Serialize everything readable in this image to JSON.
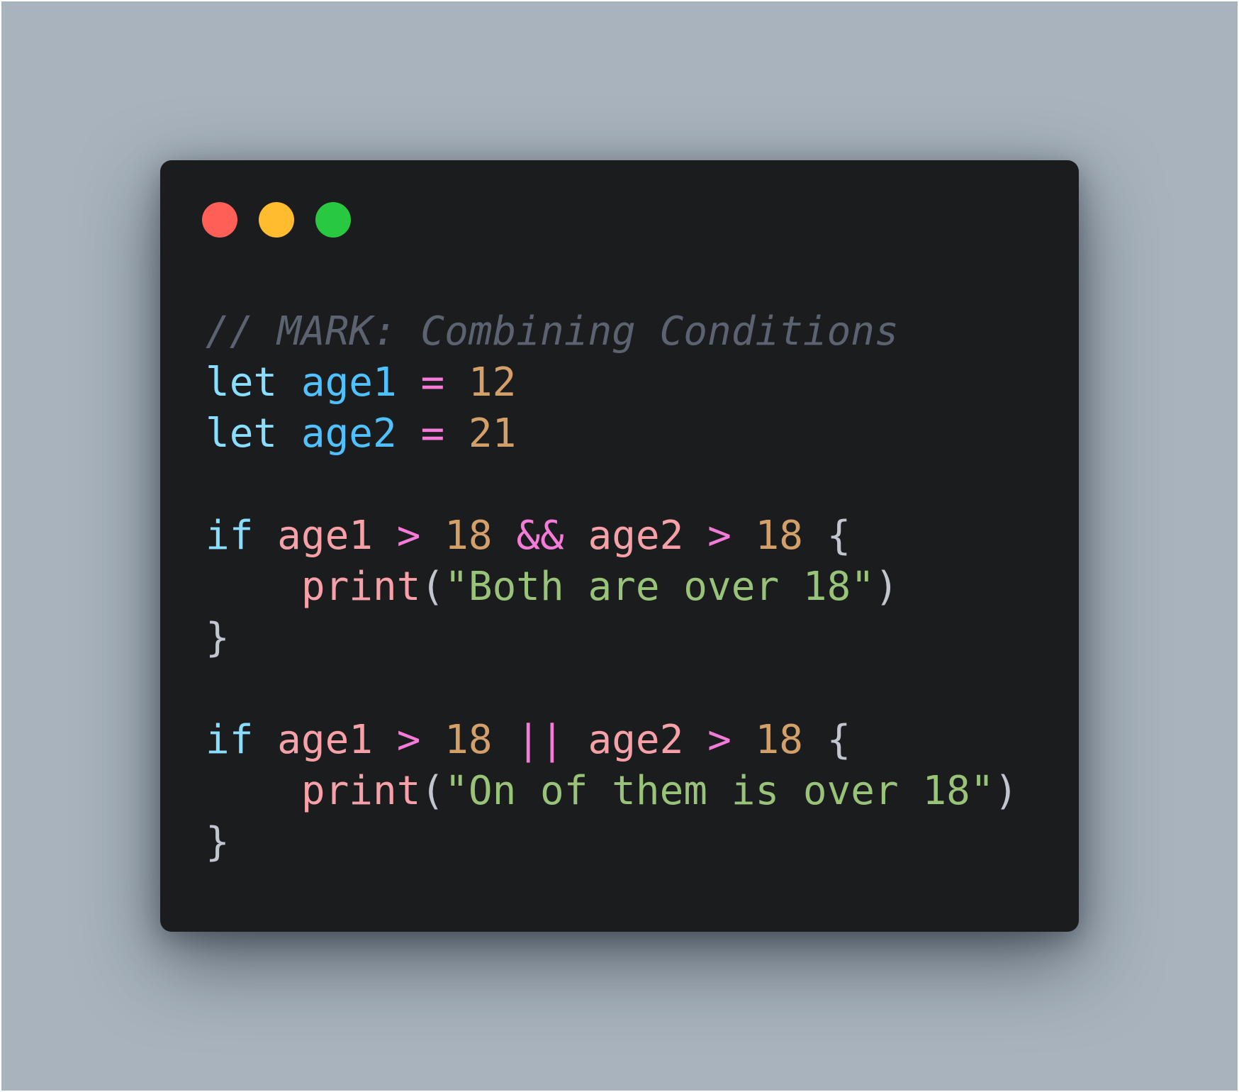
{
  "colors": {
    "background": "#a8b3bd",
    "window": "#1b1c1e",
    "dot_red": "#ff5f57",
    "dot_yellow": "#febc2e",
    "dot_green": "#28c840"
  },
  "window_controls": [
    {
      "name": "close",
      "color": "#ff5f57"
    },
    {
      "name": "minimize",
      "color": "#febc2e"
    },
    {
      "name": "zoom",
      "color": "#28c840"
    }
  ],
  "code": {
    "language": "swift",
    "lines": [
      [
        {
          "text": "// MARK: Combining Conditions",
          "type": "comment"
        }
      ],
      [
        {
          "text": "let",
          "type": "keyword"
        },
        {
          "text": " ",
          "type": "plain"
        },
        {
          "text": "age1",
          "type": "decl"
        },
        {
          "text": " ",
          "type": "plain"
        },
        {
          "text": "=",
          "type": "operator"
        },
        {
          "text": " ",
          "type": "plain"
        },
        {
          "text": "12",
          "type": "number"
        }
      ],
      [
        {
          "text": "let",
          "type": "keyword"
        },
        {
          "text": " ",
          "type": "plain"
        },
        {
          "text": "age2",
          "type": "decl"
        },
        {
          "text": " ",
          "type": "plain"
        },
        {
          "text": "=",
          "type": "operator"
        },
        {
          "text": " ",
          "type": "plain"
        },
        {
          "text": "21",
          "type": "number"
        }
      ],
      [],
      [
        {
          "text": "if",
          "type": "keyword"
        },
        {
          "text": " ",
          "type": "plain"
        },
        {
          "text": "age1",
          "type": "variable"
        },
        {
          "text": " ",
          "type": "plain"
        },
        {
          "text": ">",
          "type": "operator"
        },
        {
          "text": " ",
          "type": "plain"
        },
        {
          "text": "18",
          "type": "number"
        },
        {
          "text": " ",
          "type": "plain"
        },
        {
          "text": "&&",
          "type": "operator"
        },
        {
          "text": " ",
          "type": "plain"
        },
        {
          "text": "age2",
          "type": "variable"
        },
        {
          "text": " ",
          "type": "plain"
        },
        {
          "text": ">",
          "type": "operator"
        },
        {
          "text": " ",
          "type": "plain"
        },
        {
          "text": "18",
          "type": "number"
        },
        {
          "text": " ",
          "type": "plain"
        },
        {
          "text": "{",
          "type": "punct"
        }
      ],
      [
        {
          "text": "    ",
          "type": "plain"
        },
        {
          "text": "print",
          "type": "function"
        },
        {
          "text": "(",
          "type": "punct"
        },
        {
          "text": "\"Both are over 18\"",
          "type": "string"
        },
        {
          "text": ")",
          "type": "punct"
        }
      ],
      [
        {
          "text": "}",
          "type": "punct"
        }
      ],
      [],
      [
        {
          "text": "if",
          "type": "keyword"
        },
        {
          "text": " ",
          "type": "plain"
        },
        {
          "text": "age1",
          "type": "variable"
        },
        {
          "text": " ",
          "type": "plain"
        },
        {
          "text": ">",
          "type": "operator"
        },
        {
          "text": " ",
          "type": "plain"
        },
        {
          "text": "18",
          "type": "number"
        },
        {
          "text": " ",
          "type": "plain"
        },
        {
          "text": "||",
          "type": "operator"
        },
        {
          "text": " ",
          "type": "plain"
        },
        {
          "text": "age2",
          "type": "variable"
        },
        {
          "text": " ",
          "type": "plain"
        },
        {
          "text": ">",
          "type": "operator"
        },
        {
          "text": " ",
          "type": "plain"
        },
        {
          "text": "18",
          "type": "number"
        },
        {
          "text": " ",
          "type": "plain"
        },
        {
          "text": "{",
          "type": "punct"
        }
      ],
      [
        {
          "text": "    ",
          "type": "plain"
        },
        {
          "text": "print",
          "type": "function"
        },
        {
          "text": "(",
          "type": "punct"
        },
        {
          "text": "\"On of them is over 18\"",
          "type": "string"
        },
        {
          "text": ")",
          "type": "punct"
        }
      ],
      [
        {
          "text": "}",
          "type": "punct"
        }
      ]
    ]
  },
  "syntax_colors": {
    "comment": "#5c6370",
    "keyword": "#89ddff",
    "decl": "#4fc1ff",
    "variable": "#f7a0a8",
    "function": "#f7a0a8",
    "operator": "#f57bd8",
    "number": "#d4a06a",
    "string": "#98c379",
    "punct": "#c0c5ce",
    "plain": "#c0c5ce"
  }
}
